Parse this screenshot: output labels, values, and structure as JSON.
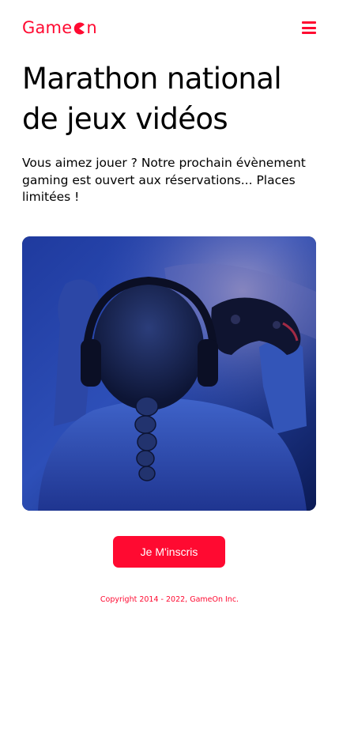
{
  "brand": {
    "name_prefix": "Game",
    "name_suffix": "n",
    "accent_color": "#FF0A31"
  },
  "nav": {
    "menu_icon": "hamburger-menu-icon"
  },
  "hero": {
    "title": "Marathon national de jeux vidéos",
    "text": "Vous aimez jouer ? Notre prochain évènement gaming est ouvert aux réservations... Places limitées !",
    "image_alt": "gamer-with-headphones-and-controller"
  },
  "cta": {
    "label": "Je M'inscris"
  },
  "footer": {
    "copyright": "Copyright 2014 - 2022, GameOn Inc."
  }
}
